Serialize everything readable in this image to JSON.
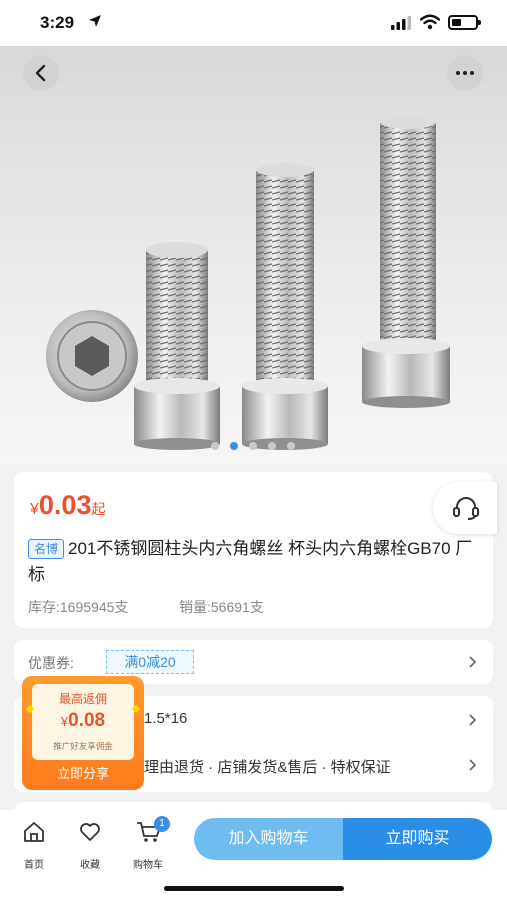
{
  "status_bar": {
    "time": "3:29",
    "battery_level": 0.4
  },
  "gallery": {
    "image_count": 5,
    "active_index": 1
  },
  "product": {
    "price_currency": "¥",
    "price_value": "0.03",
    "price_suffix": "起",
    "brand_tag": "名博",
    "title": "201不锈钢圆柱头内六角螺丝 杯头内六角螺栓GB70 厂标",
    "stock": "库存:1695945支",
    "sales": "销量:56691支"
  },
  "coupon": {
    "label": "优惠券:",
    "tag": "满0减20"
  },
  "spec": {
    "text": "1.5*16"
  },
  "services": {
    "text": "理由退货 · 店铺发货&售后 · 特权保证"
  },
  "commission": {
    "title": "最高返佣",
    "currency": "¥",
    "amount": "0.08",
    "subtitle": "推广好友享佣金",
    "button": "立即分享"
  },
  "bottom_nav": {
    "home": "首页",
    "favorites": "收藏",
    "cart": "购物车",
    "cart_count": "1",
    "add_to_cart": "加入购物车",
    "buy_now": "立即购买"
  },
  "colors": {
    "accent_blue": "#2a8de6",
    "light_blue": "#6fbcf2",
    "price_red": "#ef4d2b",
    "commission_orange": "#ff7a1e"
  }
}
